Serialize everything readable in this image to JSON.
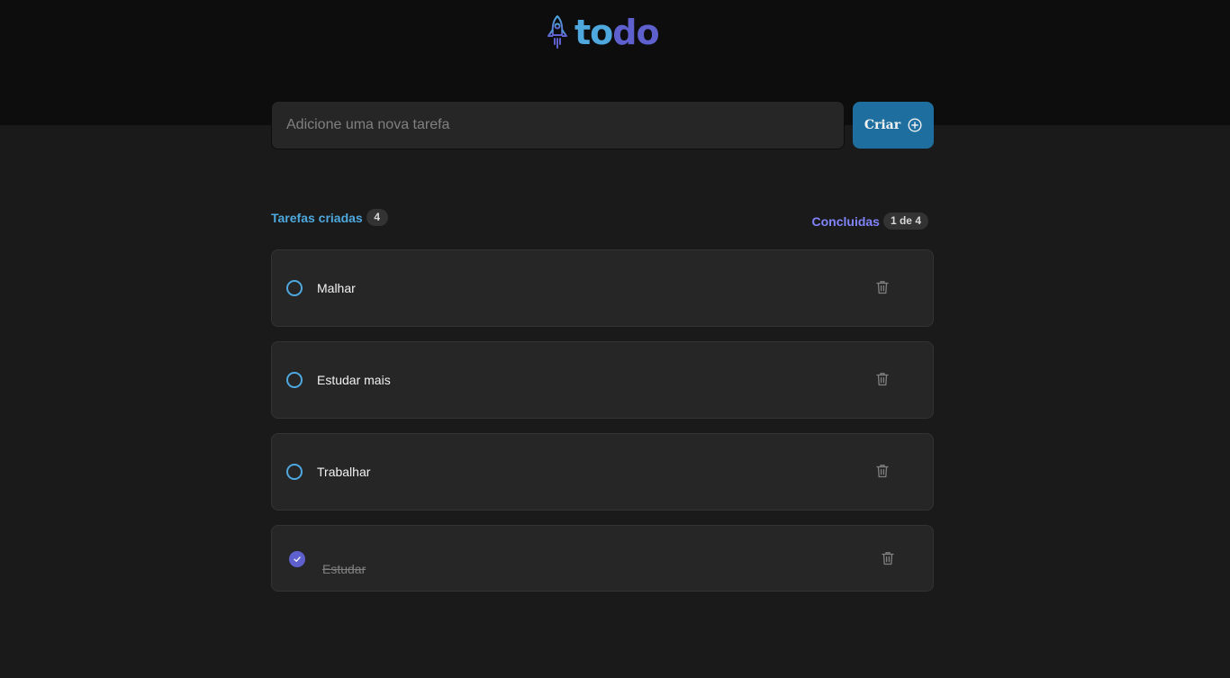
{
  "app": {
    "logo_part1": "to",
    "logo_part2": "do",
    "icon": "rocket-icon",
    "colors": {
      "blue": "#4ea8de",
      "purple": "#5e60ce",
      "button": "#1e6f9f"
    }
  },
  "new_task": {
    "placeholder": "Adicione uma nova tarefa",
    "value": "",
    "button_label": "Criar",
    "button_icon": "plus-circle-icon"
  },
  "counters": {
    "created_label": "Tarefas criadas",
    "created_count": "4",
    "done_label": "Concluidas",
    "done_count": "1 de 4"
  },
  "tasks": [
    {
      "text": "Malhar",
      "completed": false
    },
    {
      "text": "Estudar mais",
      "completed": false
    },
    {
      "text": "Trabalhar",
      "completed": false
    },
    {
      "text": "Estudar",
      "completed": true
    }
  ]
}
